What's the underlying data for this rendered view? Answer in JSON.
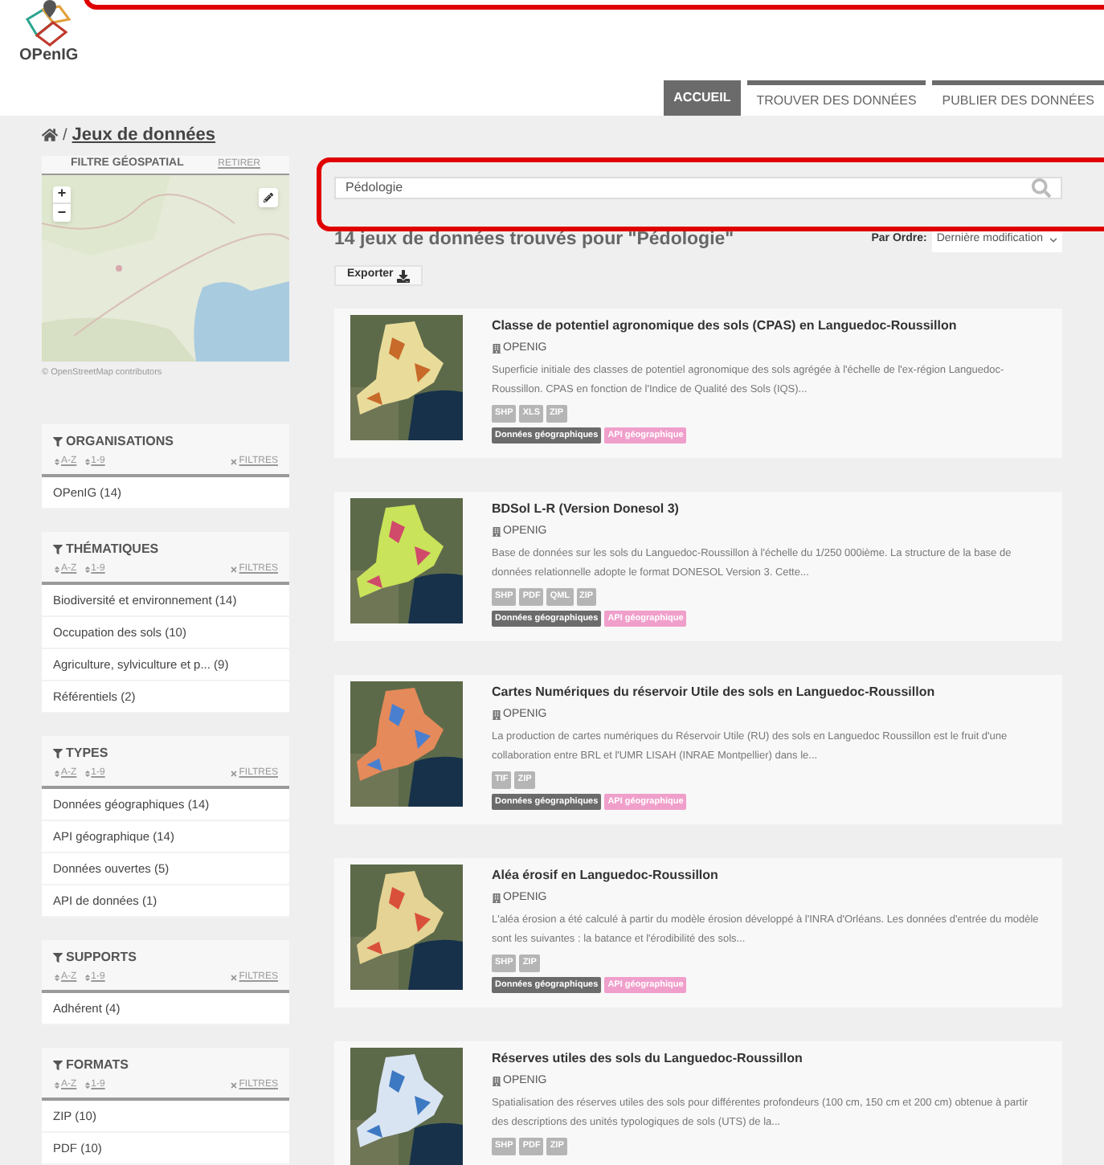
{
  "header": {
    "logo": "OPenIG",
    "nav": [
      {
        "label": "ACCUEIL",
        "selected": true
      },
      {
        "label": "TROUVER DES DONNÉES",
        "selected": false
      },
      {
        "label": "PUBLIER DES DONNÉES",
        "selected": false
      }
    ]
  },
  "breadcrumb": {
    "separator": "/",
    "current": "Jeux de données"
  },
  "geo_filter": {
    "title": "FILTRE GÉOSPATIAL",
    "action": "RETIRER",
    "zoom_in": "+",
    "zoom_out": "−",
    "attribution": "© OpenStreetMap contributors"
  },
  "facets": [
    {
      "title": "ORGANISATIONS",
      "sort_alpha": "A-Z",
      "sort_count": "1-9",
      "clear": "FILTRES",
      "items": [
        "OPenIG (14)"
      ]
    },
    {
      "title": "THÉMATIQUES",
      "sort_alpha": "A-Z",
      "sort_count": "1-9",
      "clear": "FILTRES",
      "items": [
        "Biodiversité et environnement (14)",
        "Occupation des sols (10)",
        "Agriculture, sylviculture et p... (9)",
        "Référentiels (2)"
      ]
    },
    {
      "title": "TYPES",
      "sort_alpha": "A-Z",
      "sort_count": "1-9",
      "clear": "FILTRES",
      "items": [
        "Données géographiques (14)",
        "API géographique (14)",
        "Données ouvertes (5)",
        "API de données (1)"
      ]
    },
    {
      "title": "SUPPORTS",
      "sort_alpha": "A-Z",
      "sort_count": "1-9",
      "clear": "FILTRES",
      "items": [
        "Adhérent (4)"
      ]
    },
    {
      "title": "FORMATS",
      "sort_alpha": "A-Z",
      "sort_count": "1-9",
      "clear": "FILTRES",
      "items": [
        "ZIP (10)",
        "PDF (10)"
      ]
    }
  ],
  "search": {
    "value": "Pédologie"
  },
  "results": {
    "summary": "14 jeux de données trouvés pour \"Pédologie\"",
    "sort_label": "Par Ordre:",
    "sort_value": "Dernière modification",
    "export": "Exporter"
  },
  "datasets": [
    {
      "title": "Classe de potentiel agronomique des sols (CPAS) en Languedoc-Roussillon",
      "organization": "OPENIG",
      "description": "Superficie initiale des classes de potentiel agronomique des sols agrégée à l'échelle de l'ex-région Languedoc-Roussillon. CPAS en fonction de l'Indice de Qualité des Sols (IQS)...",
      "formats": [
        "SHP",
        "XLS",
        "ZIP"
      ],
      "tags": [
        {
          "label": "Données géographiques",
          "color": "#6b6b6b"
        },
        {
          "label": "API géographique",
          "color": "#f09fcb"
        }
      ]
    },
    {
      "title": "BDSol L-R (Version Donesol 3)",
      "organization": "OPENIG",
      "description": "Base de données sur les sols du Languedoc-Roussillon à l'échelle du 1/250 000ième. La structure de la base de données relationnelle adopte le format DONESOL Version 3. Cette...",
      "formats": [
        "SHP",
        "PDF",
        "QML",
        "ZIP"
      ],
      "tags": [
        {
          "label": "Données géographiques",
          "color": "#6b6b6b"
        },
        {
          "label": "API géographique",
          "color": "#f09fcb"
        }
      ]
    },
    {
      "title": "Cartes Numériques du réservoir Utile des sols en Languedoc-Roussillon",
      "organization": "OPENIG",
      "description": "La production de cartes numériques du Réservoir Utile (RU) des sols en Languedoc Roussillon est le fruit d'une collaboration entre BRL et l'UMR LISAH (INRAE Montpellier) dans le...",
      "formats": [
        "TIF",
        "ZIP"
      ],
      "tags": [
        {
          "label": "Données géographiques",
          "color": "#6b6b6b"
        },
        {
          "label": "API géographique",
          "color": "#f09fcb"
        }
      ]
    },
    {
      "title": "Aléa érosif en Languedoc-Roussillon",
      "organization": "OPENIG",
      "description": "L'aléa érosion a été calculé à partir du modèle érosion développé à l'INRA d'Orléans. Les données d'entrée du modèle sont les suivantes : la batance et l'érodibilité des sols...",
      "formats": [
        "SHP",
        "ZIP"
      ],
      "tags": [
        {
          "label": "Données géographiques",
          "color": "#6b6b6b"
        },
        {
          "label": "API géographique",
          "color": "#f09fcb"
        }
      ]
    },
    {
      "title": "Réserves utiles des sols du Languedoc-Roussillon",
      "organization": "OPENIG",
      "description": "Spatialisation des réserves utiles des sols pour différentes profondeurs (100 cm, 150 cm et 200 cm) obtenue à partir des descriptions des unités typologiques de sols (UTS) de la...",
      "formats": [
        "SHP",
        "PDF",
        "ZIP"
      ]
    }
  ]
}
